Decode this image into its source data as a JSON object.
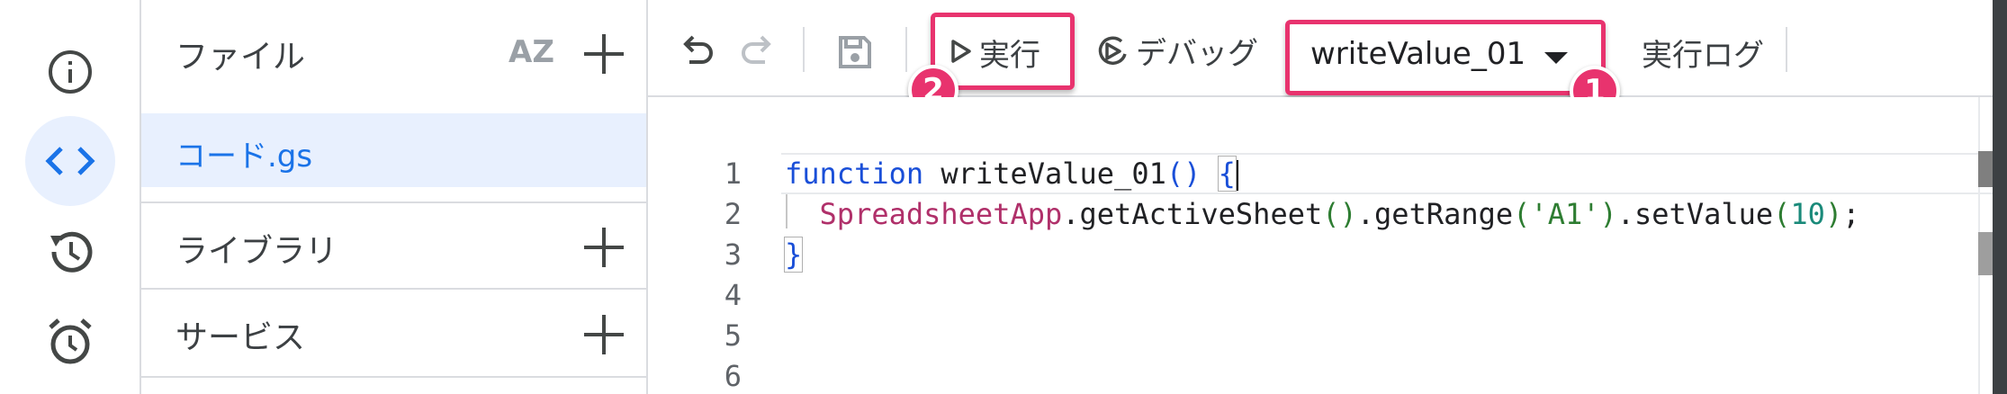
{
  "rail": {
    "icons": [
      "info-icon",
      "code-icon",
      "history-icon",
      "alarm-icon"
    ]
  },
  "panel": {
    "files_label": "ファイル",
    "sort_icon_text": "AZ",
    "file_name": "コード.gs",
    "libraries_label": "ライブラリ",
    "services_label": "サービス"
  },
  "toolbar": {
    "run_label": "実行",
    "debug_label": "デバッグ",
    "function_select": "writeValue_01",
    "log_label": "実行ログ",
    "badge_1": "1",
    "badge_2": "2",
    "highlight_color": "#e8336e"
  },
  "editor": {
    "line_numbers": [
      "1",
      "2",
      "3",
      "4",
      "5",
      "6"
    ],
    "line1": {
      "kw": "function",
      "name": " writeValue_01",
      "open": "()",
      "space": " ",
      "brace": "{"
    },
    "line2": {
      "cls": "SpreadsheetApp",
      "m1": ".getActiveSheet",
      "p1": "()",
      "m2": ".getRange",
      "po": "(",
      "str": "'A1'",
      "pc": ")",
      "m3": ".setValue",
      "po2": "(",
      "num": "10",
      "pc2": ")",
      "end": ";"
    },
    "line3": {
      "brace": "}"
    }
  }
}
